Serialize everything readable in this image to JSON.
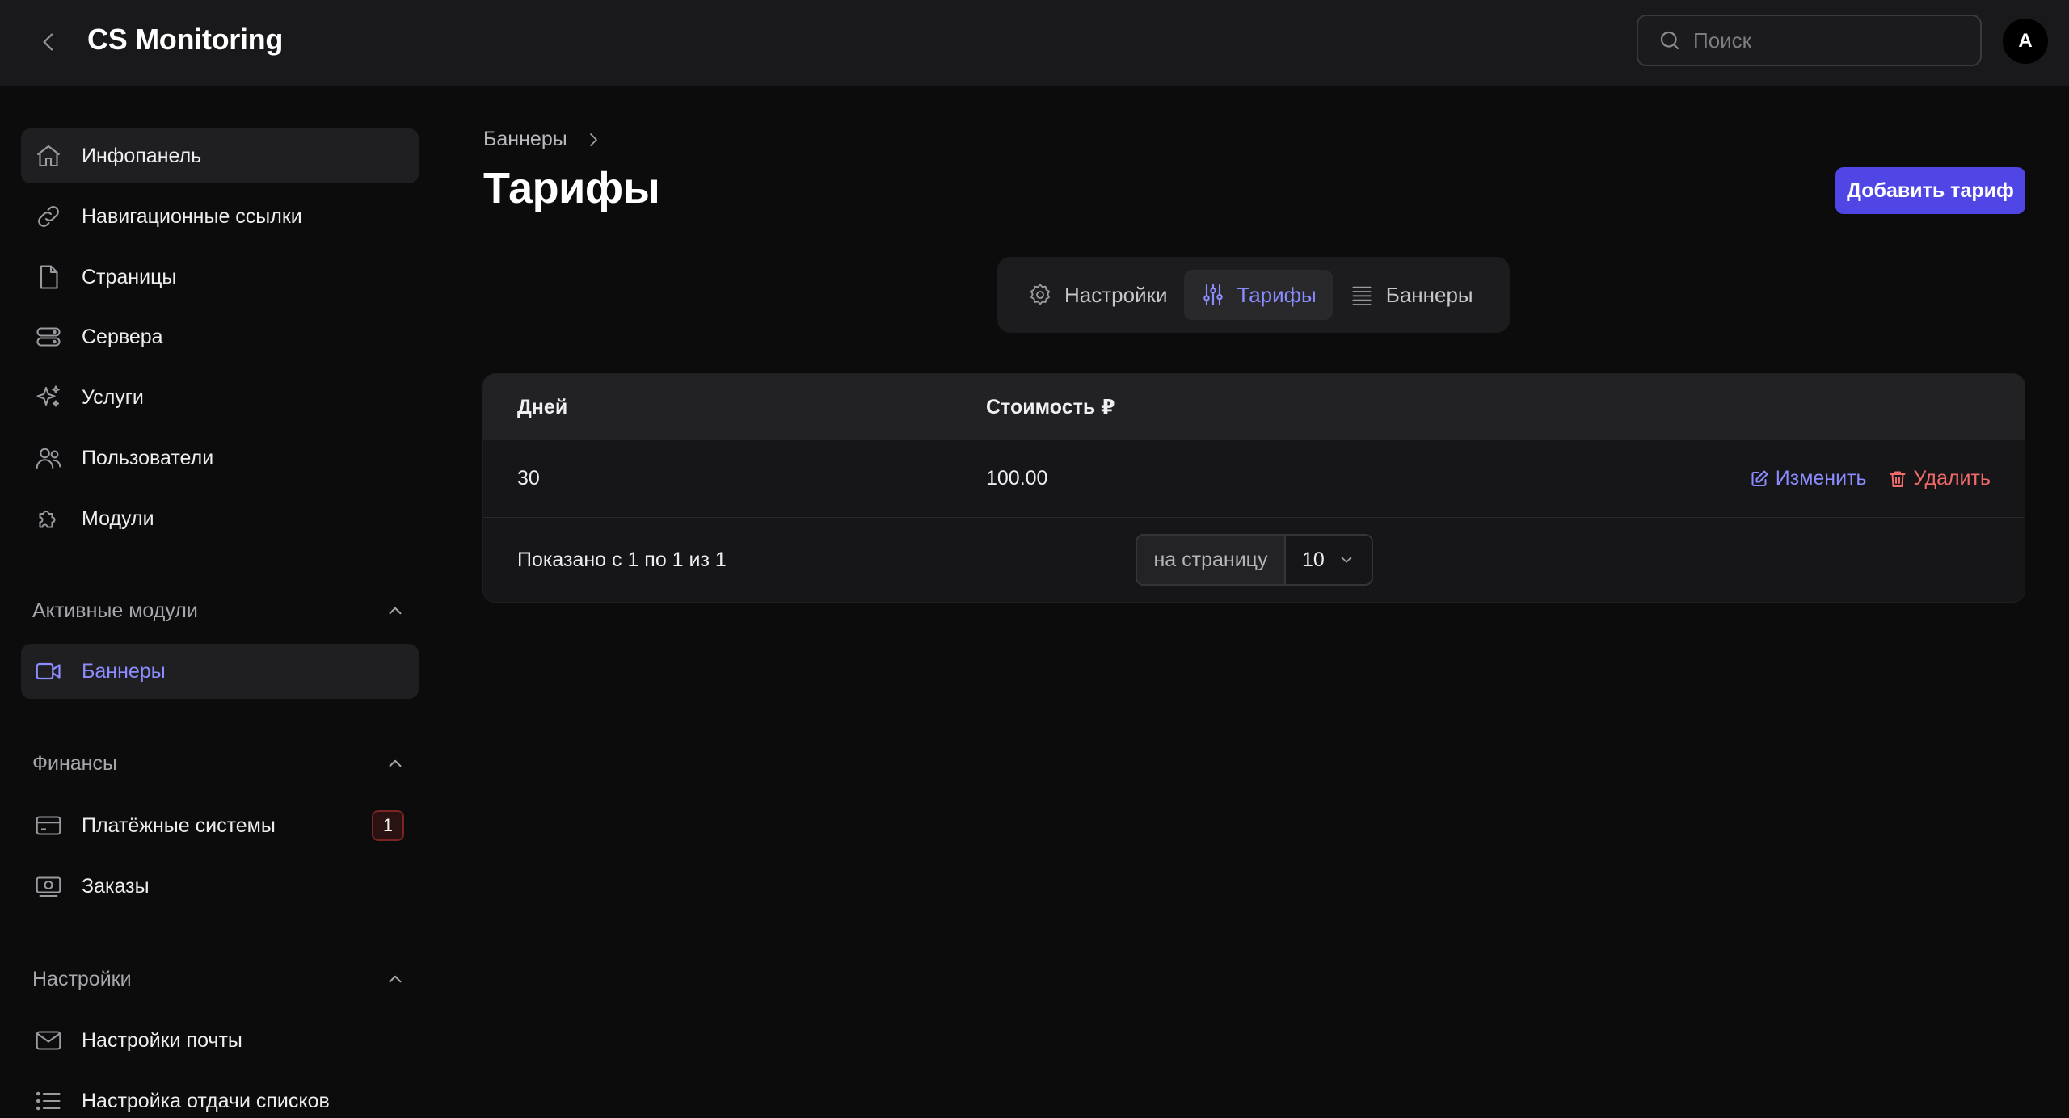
{
  "header": {
    "title": "CS Monitoring",
    "search_placeholder": "Поиск",
    "avatar_letter": "A"
  },
  "sidebar": {
    "items": [
      {
        "label": "Инфопанель",
        "icon": "home-icon"
      },
      {
        "label": "Навигационные ссылки",
        "icon": "link-icon"
      },
      {
        "label": "Страницы",
        "icon": "file-icon"
      },
      {
        "label": "Сервера",
        "icon": "server-icon"
      },
      {
        "label": "Услуги",
        "icon": "sparkles-icon"
      },
      {
        "label": "Пользователи",
        "icon": "users-icon"
      },
      {
        "label": "Модули",
        "icon": "puzzle-icon"
      }
    ],
    "sections": {
      "active_modules": {
        "title": "Активные модули",
        "items": [
          {
            "label": "Баннеры",
            "icon": "video-camera-icon"
          }
        ]
      },
      "finance": {
        "title": "Финансы",
        "items": [
          {
            "label": "Платёжные системы",
            "icon": "credit-card-icon",
            "badge": "1"
          },
          {
            "label": "Заказы",
            "icon": "banknote-icon"
          }
        ]
      },
      "settings": {
        "title": "Настройки",
        "items": [
          {
            "label": "Настройки почты",
            "icon": "mail-icon"
          },
          {
            "label": "Настройка отдачи списков",
            "icon": "list-icon"
          }
        ]
      }
    }
  },
  "main": {
    "breadcrumb": "Баннеры",
    "title": "Тарифы",
    "add_button": "Добавить тариф",
    "tabs": [
      {
        "label": "Настройки",
        "icon": "gear-icon"
      },
      {
        "label": "Тарифы",
        "icon": "sliders-icon",
        "active": true
      },
      {
        "label": "Баннеры",
        "icon": "stack-icon"
      }
    ],
    "table": {
      "columns": [
        "Дней",
        "Стоимость ₽"
      ],
      "rows": [
        {
          "days": "30",
          "price": "100.00"
        }
      ],
      "edit_label": "Изменить",
      "delete_label": "Удалить",
      "footer_text": "Показано с 1 по 1 из 1",
      "per_page_label": "на страницу",
      "per_page_value": "10"
    }
  },
  "colors": {
    "accent": "#4f46e5",
    "accent_text": "#8b8cff",
    "danger": "#f26b6b",
    "background": "#0c0c0d",
    "header_bg": "#19191b"
  }
}
